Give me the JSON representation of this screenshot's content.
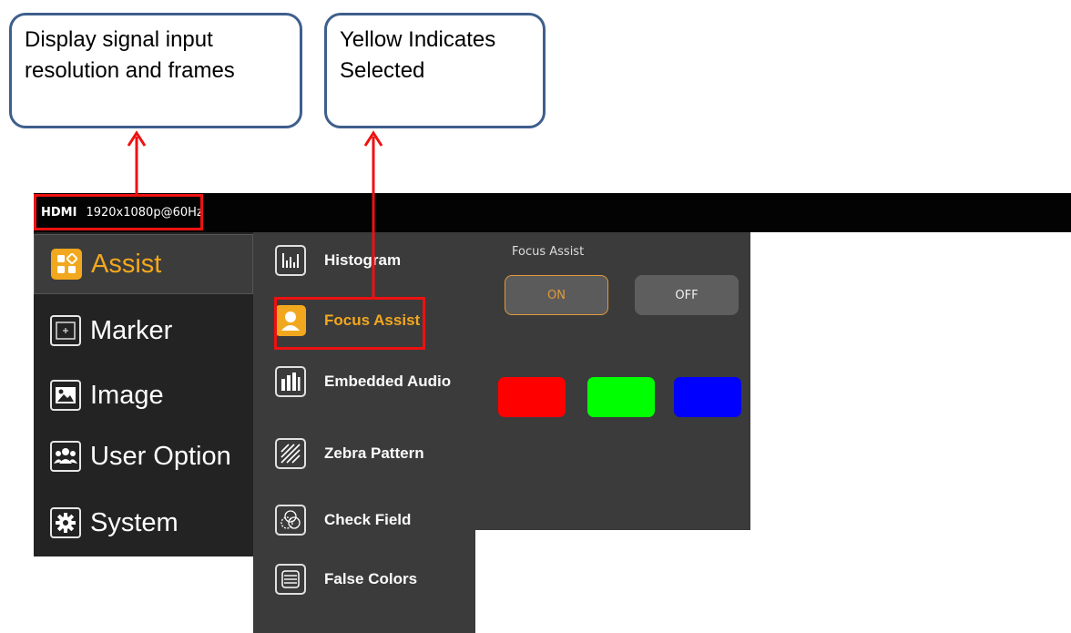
{
  "callouts": {
    "resolution": {
      "line1": "Display signal input",
      "line2": "resolution and frames"
    },
    "selected": {
      "line1": "Yellow Indicates",
      "line2": "Selected"
    }
  },
  "statusbar": {
    "source": "HDMI",
    "resolution": "1920x1080p@60Hz"
  },
  "main_menu": {
    "items": [
      {
        "label": "Assist",
        "icon": "assist-grid-icon",
        "selected": true
      },
      {
        "label": "Marker",
        "icon": "marker-frame-icon"
      },
      {
        "label": "Image",
        "icon": "image-landscape-icon"
      },
      {
        "label": "User Option",
        "icon": "user-group-icon"
      },
      {
        "label": "System",
        "icon": "gear-icon"
      }
    ]
  },
  "sub_menu": {
    "items": [
      {
        "label": "Histogram",
        "icon": "histogram-icon"
      },
      {
        "label": "Focus Assist",
        "icon": "person-icon",
        "selected": true
      },
      {
        "label": "Embedded Audio",
        "icon": "audio-bars-icon"
      },
      {
        "label": "Zebra Pattern",
        "icon": "zebra-stripes-icon"
      },
      {
        "label": "Check Field",
        "icon": "rgb-circles-icon"
      },
      {
        "label": "False Colors",
        "icon": "false-colors-icon"
      }
    ]
  },
  "panel": {
    "title": "Focus Assist",
    "on_label": "ON",
    "off_label": "OFF",
    "selected": "ON",
    "color_options": [
      "#ff0000",
      "#00ff00",
      "#0000ff"
    ]
  },
  "colors": {
    "accent": "#f2a81e",
    "highlight_box": "#ee1111",
    "callout_border": "#3f5f8c"
  }
}
